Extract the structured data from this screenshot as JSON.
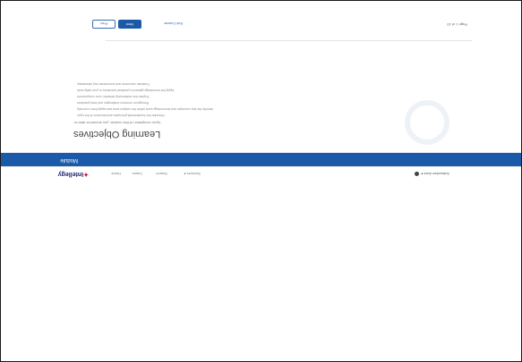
{
  "nav": {
    "logo": "Intellegy",
    "links": [
      "Home",
      "Cases",
      "Search",
      "Services"
    ],
    "user": "Subscriber Area"
  },
  "banner": {
    "title": "Module"
  },
  "content": {
    "heading": "Learning Objectives",
    "intro": "Upon completion of this module, you should be able to:",
    "objectives": [
      "Describe the fundamental principles and structure of the topic",
      "Identify the key concepts and terminology used within the subject area and apply them correctly",
      "Recognize common challenges and best practices",
      "Explain the relationship between core components",
      "Apply the knowledge gained to practical scenarios in your daily work",
      "Evaluate outcomes and summarize key takeaways"
    ]
  },
  "footer": {
    "page_indicator": "Page 1 of 10",
    "prev_label": "Prev",
    "next_label": "Next",
    "back_label": "Exit Course"
  }
}
